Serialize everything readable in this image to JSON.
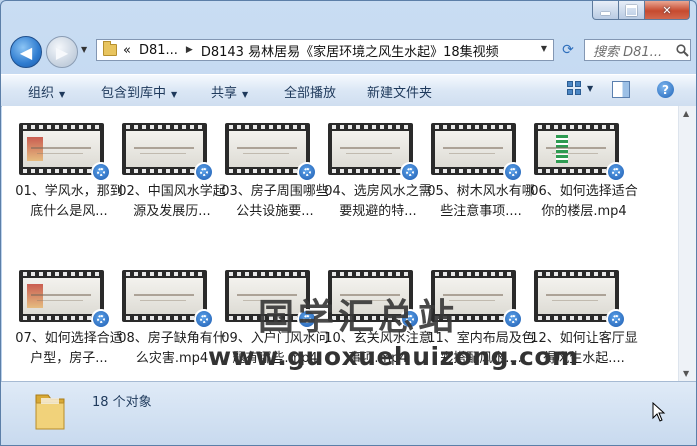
{
  "window": {
    "caption_buttons": [
      "minimize",
      "maximize",
      "close"
    ]
  },
  "address": {
    "chevron": "«",
    "crumb1": "D81...",
    "crumb2": "D8143 易林居易《家居环境之风生水起》18集视频",
    "search_placeholder": "搜索 D81..."
  },
  "toolbar": {
    "organize": "组织",
    "include_library": "包含到库中",
    "share": "共享",
    "play_all": "全部播放",
    "new_folder": "新建文件夹"
  },
  "files": [
    {
      "label": "01、学风水，那到底什么是风...",
      "thumb": "pic"
    },
    {
      "label": "02、中国风水学起源及发展历...",
      "thumb": "text"
    },
    {
      "label": "03、房子周围哪些公共设施要...",
      "thumb": "text"
    },
    {
      "label": "04、选房风水之需要规避的特...",
      "thumb": "text"
    },
    {
      "label": "05、树木风水有哪些注意事项....",
      "thumb": "text"
    },
    {
      "label": "06、如何选择适合你的楼层.mp4",
      "thumb": "building"
    },
    {
      "label": "07、如何选择合适户型，房子...",
      "thumb": "pic"
    },
    {
      "label": "08、房子缺角有什么灾害.mp4",
      "thumb": "text"
    },
    {
      "label": "09、入户门风水问题有哪些.mp4",
      "thumb": "text"
    },
    {
      "label": "10、玄关风水注意事项.mp4",
      "thumb": "text"
    },
    {
      "label": "11、室内布局及色彩搭配风水....",
      "thumb": "text"
    },
    {
      "label": "12、如何让客厅显得风生水起....",
      "thumb": "text"
    }
  ],
  "watermark": {
    "line1": "国学汇总站",
    "line2": "www.guoxuehuizong.com"
  },
  "status": {
    "count_text": "18 个对象"
  },
  "colors": {
    "window_chrome": "#bcd3ec",
    "accent_blue": "#1d5bb0",
    "close_red": "#c64a2f"
  }
}
